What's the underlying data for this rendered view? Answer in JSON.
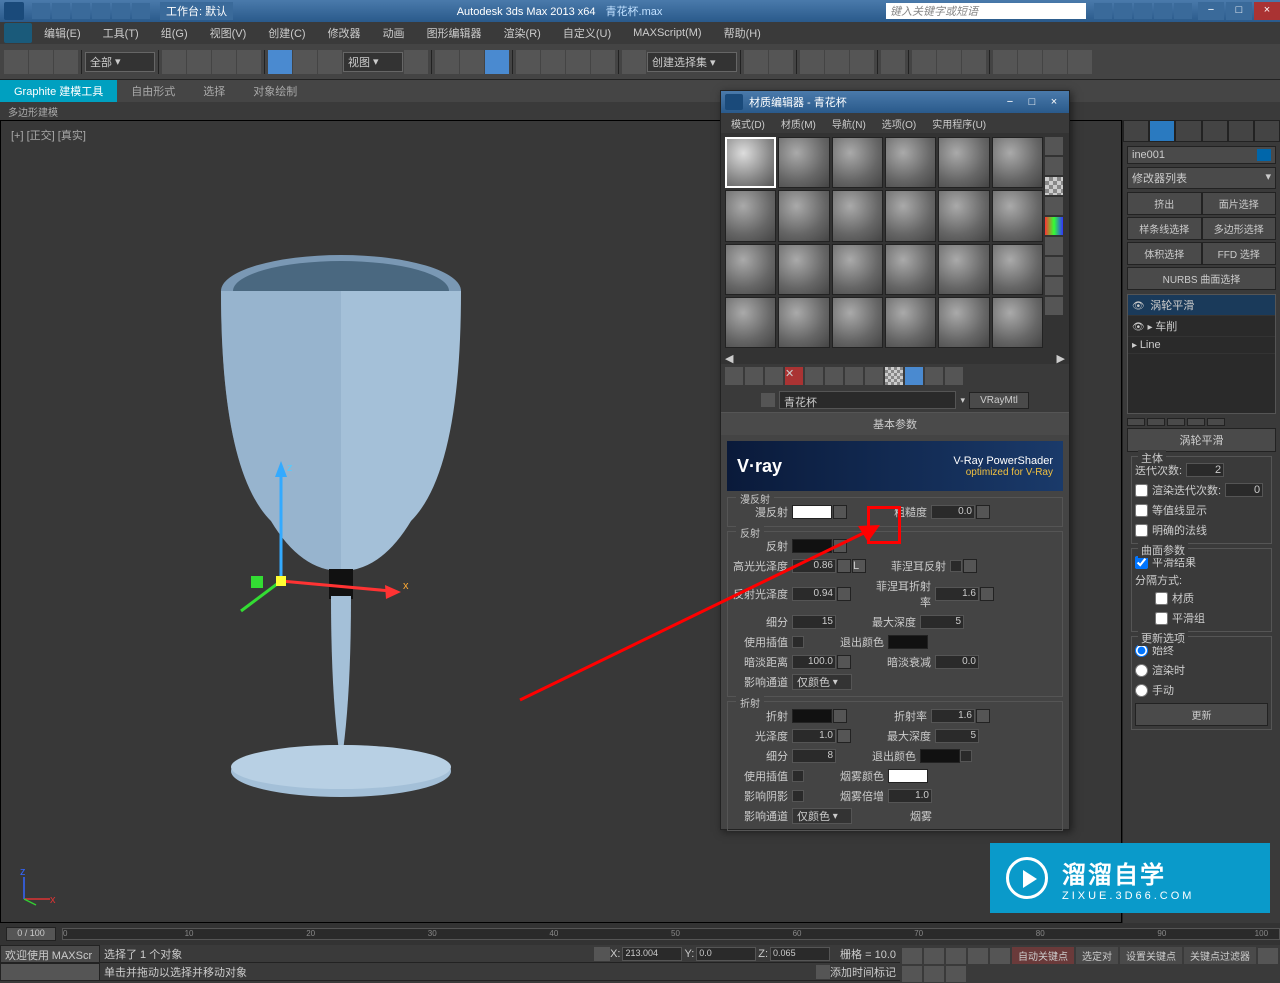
{
  "titlebar": {
    "workspace_label": "工作台: 默认",
    "app_title": "Autodesk 3ds Max  2013 x64",
    "file_name": "青花杯.max",
    "search_placeholder": "键入关键字或短语",
    "min": "−",
    "max": "□",
    "close": "×"
  },
  "menu": {
    "edit": "编辑(E)",
    "tools": "工具(T)",
    "group": "组(G)",
    "view": "视图(V)",
    "create": "创建(C)",
    "modifier": "修改器",
    "anim": "动画",
    "graph": "图形编辑器",
    "render": "渲染(R)",
    "custom": "自定义(U)",
    "maxscript": "MAXScript(M)",
    "help": "帮助(H)"
  },
  "toolbar": {
    "all": "全部",
    "view_combo": "视图"
  },
  "ribbon": {
    "tab1": "Graphite 建模工具",
    "tab2": "自由形式",
    "tab3": "选择",
    "tab4": "对象绘制",
    "sub": "多边形建模"
  },
  "viewport": {
    "label": "[+] [正交] [真实]"
  },
  "rightpanel": {
    "object_name": "ine001",
    "modifier_list": "修改器列表",
    "stack": {
      "turbosmooth": "涡轮平滑",
      "lathe": "车削",
      "line": "Line"
    },
    "btns": {
      "extrude": "挤出",
      "face_select": "面片选择",
      "spline_select": "样条线选择",
      "poly_select": "多边形选择",
      "vol_select": "体积选择",
      "ffd_select": "FFD 选择",
      "nurbs": "NURBS 曲面选择"
    },
    "rollout_title": "涡轮平滑",
    "main_group": "主体",
    "iter_label": "迭代次数:",
    "iter_val": "2",
    "render_iter_label": "渲染迭代次数:",
    "render_iter_val": "0",
    "iso_label": "等值线显示",
    "explicit_label": "明确的法线",
    "surface_group": "曲面参数",
    "smooth_result": "平滑结果",
    "sep_method": "分隔方式:",
    "by_mat": "材质",
    "by_smooth": "平滑组",
    "update_group": "更新选项",
    "always": "始终",
    "on_render": "渲染时",
    "manual": "手动",
    "update_btn": "更新"
  },
  "material_editor": {
    "title": "材质编辑器 - 青花杯",
    "menu": {
      "mode": "模式(D)",
      "material": "材质(M)",
      "nav": "导航(N)",
      "option": "选项(O)",
      "util": "实用程序(U)"
    },
    "name": "青花杯",
    "type": "VRayMtl",
    "basic_params": "基本参数",
    "vray": {
      "title": "V-Ray PowerShader",
      "sub": "optimized for V-Ray",
      "logo": "V·ray"
    },
    "diffuse_group": "漫反射",
    "diffuse_label": "漫反射",
    "roughness_label": "粗糙度",
    "roughness_val": "0.0",
    "reflect_group": "反射",
    "reflect_label": "反射",
    "hilight_label": "高光光泽度",
    "hilight_val": "0.86",
    "lock": "L",
    "refl_gloss_label": "反射光泽度",
    "refl_gloss_val": "0.94",
    "fresnel_label": "菲涅耳反射",
    "fresnel_ior_label": "菲涅耳折射率",
    "fresnel_ior_val": "1.6",
    "subdiv_label": "细分",
    "subdiv_val": "15",
    "max_depth_label": "最大深度",
    "max_depth_val": "5",
    "use_interp_label": "使用插值",
    "exit_color_label": "退出颜色",
    "dim_dist_label": "暗淡距离",
    "dim_dist_val": "100.0",
    "dim_falloff_label": "暗淡衰减",
    "dim_falloff_val": "0.0",
    "affect_channel_label": "影响通道",
    "affect_channel_val": "仅颜色",
    "refract_group": "折射",
    "refract_label": "折射",
    "ior_label": "折射率",
    "ior_val": "1.6",
    "gloss_label": "光泽度",
    "gloss_val": "1.0",
    "refr_max_depth_label": "最大深度",
    "refr_max_depth_val": "5",
    "refr_subdiv_label": "细分",
    "refr_subdiv_val": "8",
    "refr_exit_label": "退出颜色",
    "refr_interp_label": "使用插值",
    "fog_color_label": "烟雾颜色",
    "affect_shadow_label": "影响阴影",
    "fog_mult_label": "烟雾倍增",
    "fog_mult_val": "1.0",
    "refr_affect_label": "影响通道",
    "refr_affect_val": "仅颜色",
    "fog_label": "烟雾"
  },
  "timeline": {
    "pos": "0 / 100"
  },
  "statusbar": {
    "welcome": "欢迎使用",
    "maxscr": "MAXScr",
    "selected": "选择了 1 个对象",
    "hint": "单击并拖动以选择并移动对象",
    "x": "X:",
    "x_val": "213.004",
    "y": "Y:",
    "y_val": "0.0",
    "z": "Z:",
    "z_val": "0.065",
    "grid": "栅格 = 10.0",
    "add_time": "添加时间标记",
    "autokey": "自动关键点",
    "selected_only": "选定对",
    "setkey": "设置关键点",
    "keyfilter": "关键点过滤器"
  },
  "watermark": {
    "big": "溜溜自学",
    "small": "ZIXUE.3D66.COM"
  }
}
